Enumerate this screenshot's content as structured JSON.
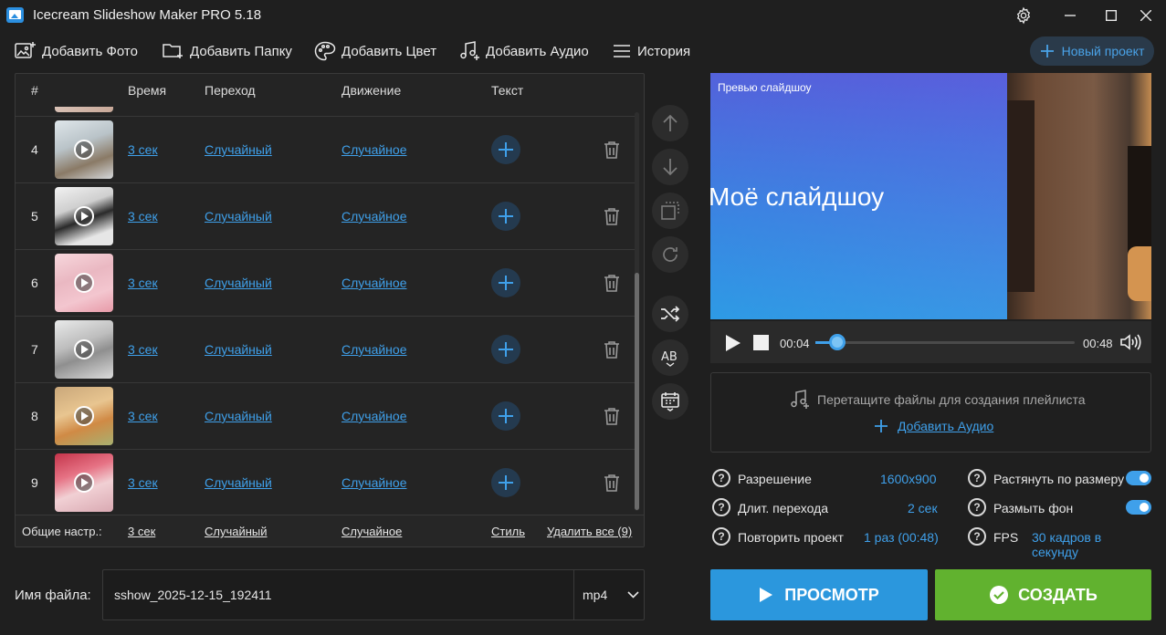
{
  "window": {
    "title": "Icecream Slideshow Maker PRO 5.18"
  },
  "toolbar": {
    "add_photo": "Добавить Фото",
    "add_folder": "Добавить Папку",
    "add_color": "Добавить Цвет",
    "add_audio": "Добавить Аудио",
    "history": "История",
    "new_project": "Новый проект"
  },
  "table": {
    "headers": {
      "num": "#",
      "time": "Время",
      "transition": "Переход",
      "motion": "Движение",
      "text": "Текст"
    },
    "rows": [
      {
        "num": "4",
        "time": "3 сек",
        "transition": "Случайный",
        "motion": "Случайное"
      },
      {
        "num": "5",
        "time": "3 сек",
        "transition": "Случайный",
        "motion": "Случайное"
      },
      {
        "num": "6",
        "time": "3 сек",
        "transition": "Случайный",
        "motion": "Случайное"
      },
      {
        "num": "7",
        "time": "3 сек",
        "transition": "Случайный",
        "motion": "Случайное"
      },
      {
        "num": "8",
        "time": "3 сек",
        "transition": "Случайный",
        "motion": "Случайное"
      },
      {
        "num": "9",
        "time": "3 сек",
        "transition": "Случайный",
        "motion": "Случайное"
      }
    ],
    "footer": {
      "label": "Общие настр.:",
      "time": "3 сек",
      "transition": "Случайный",
      "motion": "Случайное",
      "style": "Стиль",
      "delete_all": "Удалить все (9)"
    }
  },
  "preview": {
    "label": "Превью слайдшоу",
    "title_text": "Моё слайдшоу",
    "current_time": "00:04",
    "total_time": "00:48",
    "progress": 0.083
  },
  "audio": {
    "hint": "Перетащите файлы для создания плейлиста",
    "add": "Добавить Аудио"
  },
  "settings": {
    "resolution_label": "Разрешение",
    "resolution_value": "1600x900",
    "transition_label": "Длит. перехода",
    "transition_value": "2 сек",
    "repeat_label": "Повторить проект",
    "repeat_value": "1 раз (00:48)",
    "stretch_label": "Растянуть по размеру",
    "stretch_on": true,
    "blur_label": "Размыть фон",
    "blur_on": true,
    "fps_label": "FPS",
    "fps_value": "30 кадров в секунду"
  },
  "file": {
    "label": "Имя файла:",
    "name": "sshow_2025-12-15_192411",
    "format": "mp4"
  },
  "buttons": {
    "preview": "ПРОСМОТР",
    "create": "СОЗДАТЬ"
  },
  "colors": {
    "accent": "#3fa0ea",
    "preview_btn": "#2b97dd",
    "create_btn": "#61b22f",
    "background": "#1f1f1f"
  }
}
